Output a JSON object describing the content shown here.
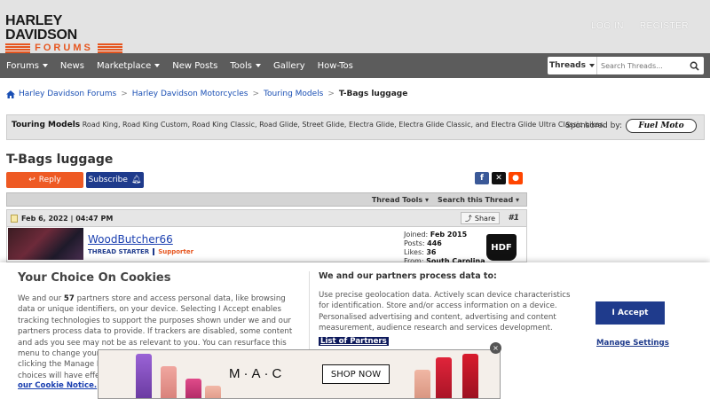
{
  "header": {
    "logo_line1": "HARLEY DAVIDSON",
    "logo_line2": "FORUMS",
    "login": "LOG IN",
    "register": "REGISTER"
  },
  "nav": {
    "items": [
      "Forums",
      "News",
      "Marketplace",
      "New Posts",
      "Tools",
      "Gallery",
      "How-Tos"
    ],
    "search_scope": "Threads",
    "search_placeholder": "Search Threads..."
  },
  "breadcrumb": [
    "Harley Davidson Forums",
    "Harley Davidson Motorcycles",
    "Touring Models",
    "T-Bags luggage"
  ],
  "notice": {
    "title": "Touring Models",
    "text": "Road King, Road King Custom, Road King Classic, Road Glide, Street Glide, Electra Glide, Electra Glide Classic, and Electra Glide Ultra Classic bikes.",
    "sponsored_by": "Sponsored by:",
    "sponsor_name": "Fuel Moto"
  },
  "thread": {
    "title": "T-Bags luggage",
    "reply": "Reply",
    "subscribe": "Subscribe",
    "thread_tools": "Thread Tools",
    "search_thread": "Search this Thread"
  },
  "post": {
    "date": "Feb 6, 2022 | 04:47 PM",
    "share": "Share",
    "number": "#1",
    "username": "WoodButcher66",
    "role": "THREAD STARTER",
    "status": "Supporter",
    "joined_label": "Joined:",
    "joined": "Feb 2015",
    "posts_label": "Posts:",
    "posts": "446",
    "likes_label": "Likes:",
    "likes": "36",
    "from_label": "From:",
    "from": "South Carolina",
    "badge": "HDF"
  },
  "cookie": {
    "title": "Your Choice On Cookies",
    "p1": "We and our",
    "count": "57",
    "p2": "partners store and access personal data, like browsing data or unique identifiers, on your device. Selecting I Accept enables tracking technologies to support the purposes shown under we and our partners process data to provide. If trackers are disabled, some content and ads you see may not be as relevant to you. You can resurface this menu to change your choices or withdraw consent at any time by clicking the Manage Preferences link on the bottom of the webpage. Your choices will have effect within our Website. For more details, refer to",
    "policy": "our Cookie Notice.",
    "mid_title": "We and our partners process data to:",
    "mid_text": "Use precise geolocation data. Actively scan device characteristics for identification. Store and/or access information on a device. Personalised advertising and content, advertising and content measurement, audience research and services development.",
    "partners": "List of Partners",
    "accept": "I Accept",
    "manage": "Manage Settings"
  },
  "ad": {
    "brand": "M·A·C",
    "cta": "SHOP NOW",
    "close": "×"
  }
}
